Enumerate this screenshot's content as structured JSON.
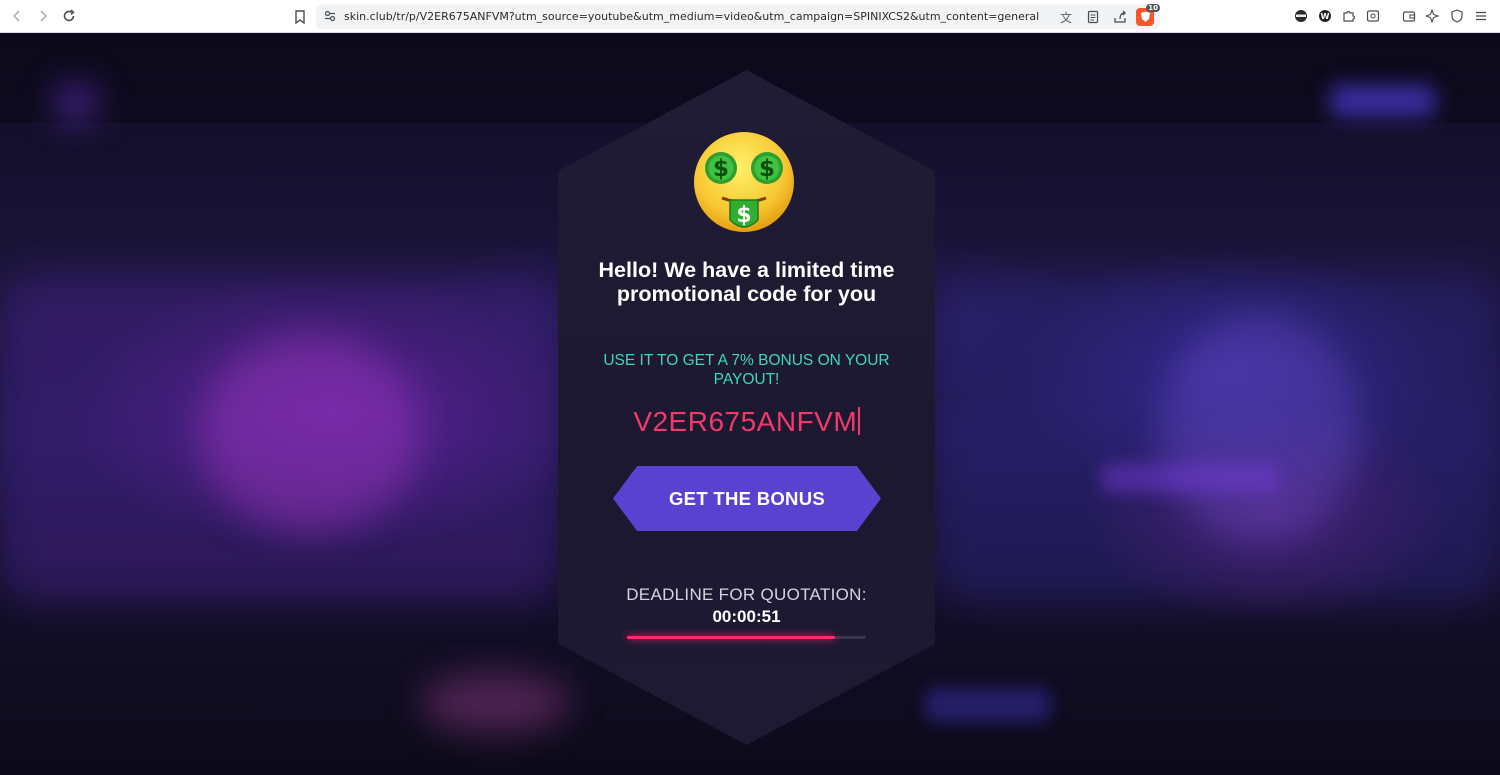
{
  "browser": {
    "url": "skin.club/tr/p/V2ER675ANFVM?utm_source=youtube&utm_medium=video&utm_campaign=SPINIXCS2&utm_content=general",
    "brave_badge": "10"
  },
  "modal": {
    "emoji_icon": "money-mouth-face-icon",
    "title": "Hello! We have a limited time promotional code for you",
    "subtitle": "USE IT TO GET A 7% BONUS ON YOUR PAYOUT!",
    "promo_code": "V2ER675ANFVM",
    "button_label": "GET THE BONUS",
    "deadline_label": "DEADLINE FOR QUOTATION:",
    "timer": "00:00:51",
    "progress": 0.87
  },
  "colors": {
    "subtitle": "#3ad8c3",
    "promo_code": "#ef3a6a",
    "button": "#5a42d0",
    "progress": "#ff2a6a"
  }
}
